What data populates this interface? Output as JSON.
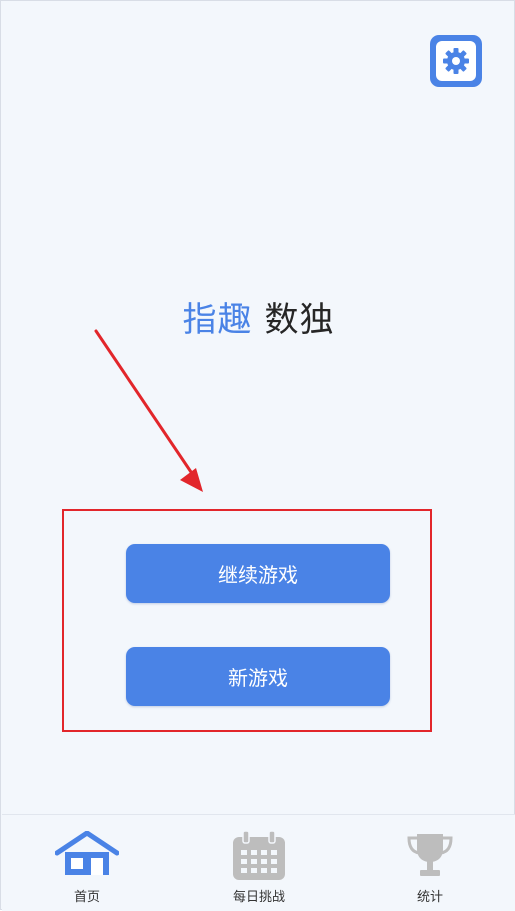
{
  "app": {
    "title_brand": "指趣",
    "title_rest": "数独"
  },
  "header": {
    "settings_icon": "gear-icon"
  },
  "main": {
    "continue_label": "继续游戏",
    "new_game_label": "新游戏"
  },
  "tabs": [
    {
      "label": "首页",
      "icon": "home-icon",
      "active": true
    },
    {
      "label": "每日挑战",
      "icon": "calendar-icon",
      "active": false
    },
    {
      "label": "统计",
      "icon": "trophy-icon",
      "active": false
    }
  ],
  "colors": {
    "accent": "#4a83e6",
    "background": "#f3f7fc",
    "annotation": "#e2262b",
    "inactive_icon": "#bdbdbd"
  }
}
